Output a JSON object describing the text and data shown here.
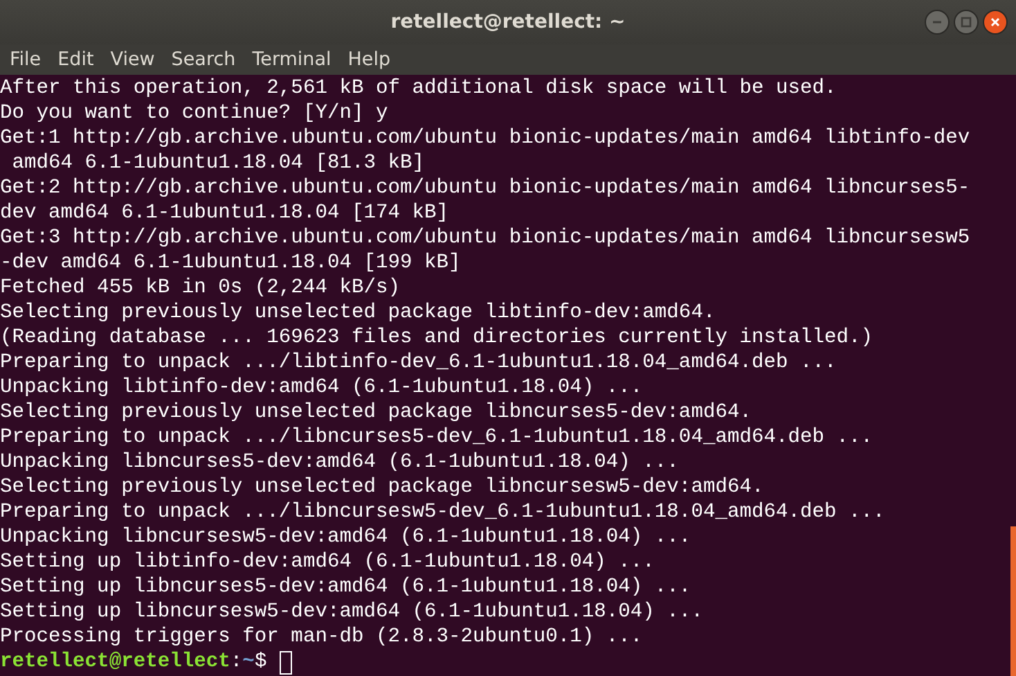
{
  "window": {
    "title": "retellect@retellect: ~"
  },
  "menu": [
    "File",
    "Edit",
    "View",
    "Search",
    "Terminal",
    "Help"
  ],
  "terminal": {
    "lines": [
      "After this operation, 2,561 kB of additional disk space will be used.",
      "Do you want to continue? [Y/n] y",
      "Get:1 http://gb.archive.ubuntu.com/ubuntu bionic-updates/main amd64 libtinfo-dev",
      " amd64 6.1-1ubuntu1.18.04 [81.3 kB]",
      "Get:2 http://gb.archive.ubuntu.com/ubuntu bionic-updates/main amd64 libncurses5-",
      "dev amd64 6.1-1ubuntu1.18.04 [174 kB]",
      "Get:3 http://gb.archive.ubuntu.com/ubuntu bionic-updates/main amd64 libncursesw5",
      "-dev amd64 6.1-1ubuntu1.18.04 [199 kB]",
      "Fetched 455 kB in 0s (2,244 kB/s)",
      "Selecting previously unselected package libtinfo-dev:amd64.",
      "(Reading database ... 169623 files and directories currently installed.)",
      "Preparing to unpack .../libtinfo-dev_6.1-1ubuntu1.18.04_amd64.deb ...",
      "Unpacking libtinfo-dev:amd64 (6.1-1ubuntu1.18.04) ...",
      "Selecting previously unselected package libncurses5-dev:amd64.",
      "Preparing to unpack .../libncurses5-dev_6.1-1ubuntu1.18.04_amd64.deb ...",
      "Unpacking libncurses5-dev:amd64 (6.1-1ubuntu1.18.04) ...",
      "Selecting previously unselected package libncursesw5-dev:amd64.",
      "Preparing to unpack .../libncursesw5-dev_6.1-1ubuntu1.18.04_amd64.deb ...",
      "Unpacking libncursesw5-dev:amd64 (6.1-1ubuntu1.18.04) ...",
      "Setting up libtinfo-dev:amd64 (6.1-1ubuntu1.18.04) ...",
      "Setting up libncurses5-dev:amd64 (6.1-1ubuntu1.18.04) ...",
      "Setting up libncursesw5-dev:amd64 (6.1-1ubuntu1.18.04) ...",
      "Processing triggers for man-db (2.8.3-2ubuntu0.1) ..."
    ],
    "prompt": {
      "user_host": "retellect@retellect",
      "separator": ":",
      "path": "~",
      "symbol": "$"
    }
  }
}
